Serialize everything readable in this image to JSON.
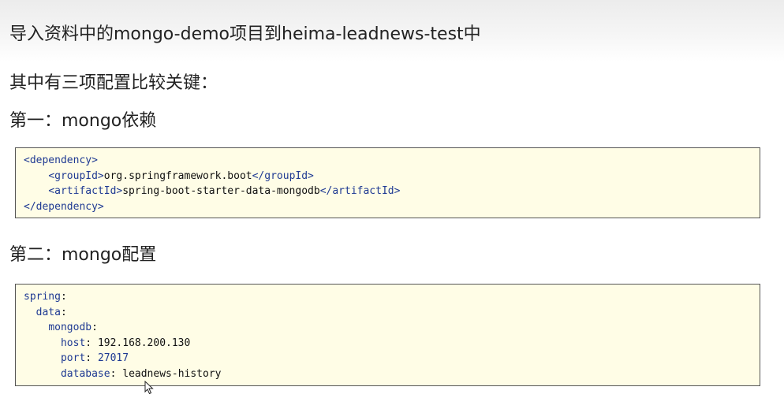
{
  "title": "导入资料中的mongo-demo项目到heima-leadnews-test中",
  "section_key": "其中有三项配置比较关键：",
  "section_first": "第一：mongo依赖",
  "section_second": "第二：mongo配置",
  "dependency_code": {
    "dependency_open": "<dependency>",
    "group_open": "<groupId>",
    "group_value": "org.springframework.boot",
    "group_close": "</groupId>",
    "artifact_open": "<artifactId>",
    "artifact_value": "spring-boot-starter-data-mongodb",
    "artifact_close": "</artifactId>",
    "dependency_close": "</dependency>"
  },
  "yaml_code": {
    "spring_key": "spring",
    "data_key": "data",
    "mongodb_key": "mongodb",
    "host_key": "host",
    "host_value": "192.168.200.130",
    "port_key": "port",
    "port_value": "27017",
    "database_key": "database",
    "database_value": "leadnews-history"
  },
  "colors": {
    "code_background": "#fffde6",
    "code_keyword": "#1f3a93"
  }
}
